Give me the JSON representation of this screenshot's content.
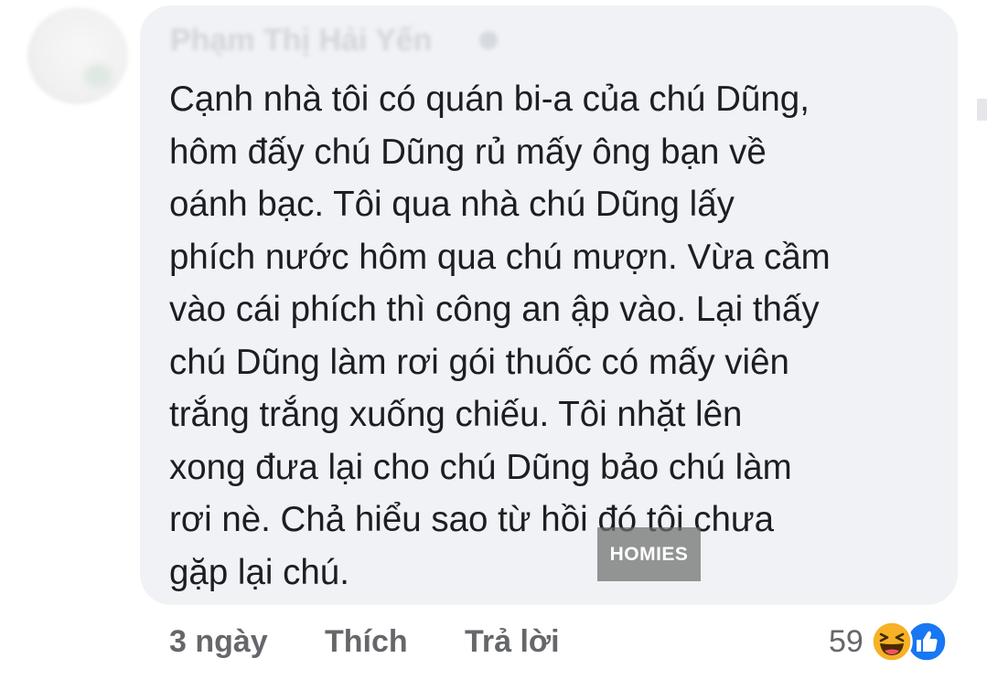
{
  "comment": {
    "author": "Phạm Thị Hải Yến",
    "text_lines": [
      "Cạnh nhà tôi có quán bi-a của chú Dũng,",
      "hôm đấy chú Dũng rủ mấy ông bạn về",
      "oánh bạc. Tôi qua nhà chú Dũng lấy",
      "phích nước hôm qua chú mượn. Vừa cầm",
      "vào cái phích thì công an ập vào. Lại thấy",
      "chú Dũng làm rơi gói thuốc có mấy viên",
      "trắng trắng xuống chiếu. Tôi nhặt lên",
      "xong đưa lại cho chú Dũng bảo chú làm",
      "rơi nè. Chả hiểu sao từ hồi đó tôi chưa",
      "gặp lại chú."
    ],
    "watermark": "HOMIES"
  },
  "actions": {
    "time": "3 ngày",
    "like_label": "Thích",
    "reply_label": "Trả lời"
  },
  "reactions": {
    "count": "59",
    "icons": [
      "haha-icon",
      "like-icon"
    ]
  },
  "colors": {
    "bubble_bg": "#f0f2f5",
    "text": "#1c1e21",
    "meta_text": "#65676b",
    "like_blue": "#1877f2",
    "haha_yellow": "#f7b125"
  }
}
